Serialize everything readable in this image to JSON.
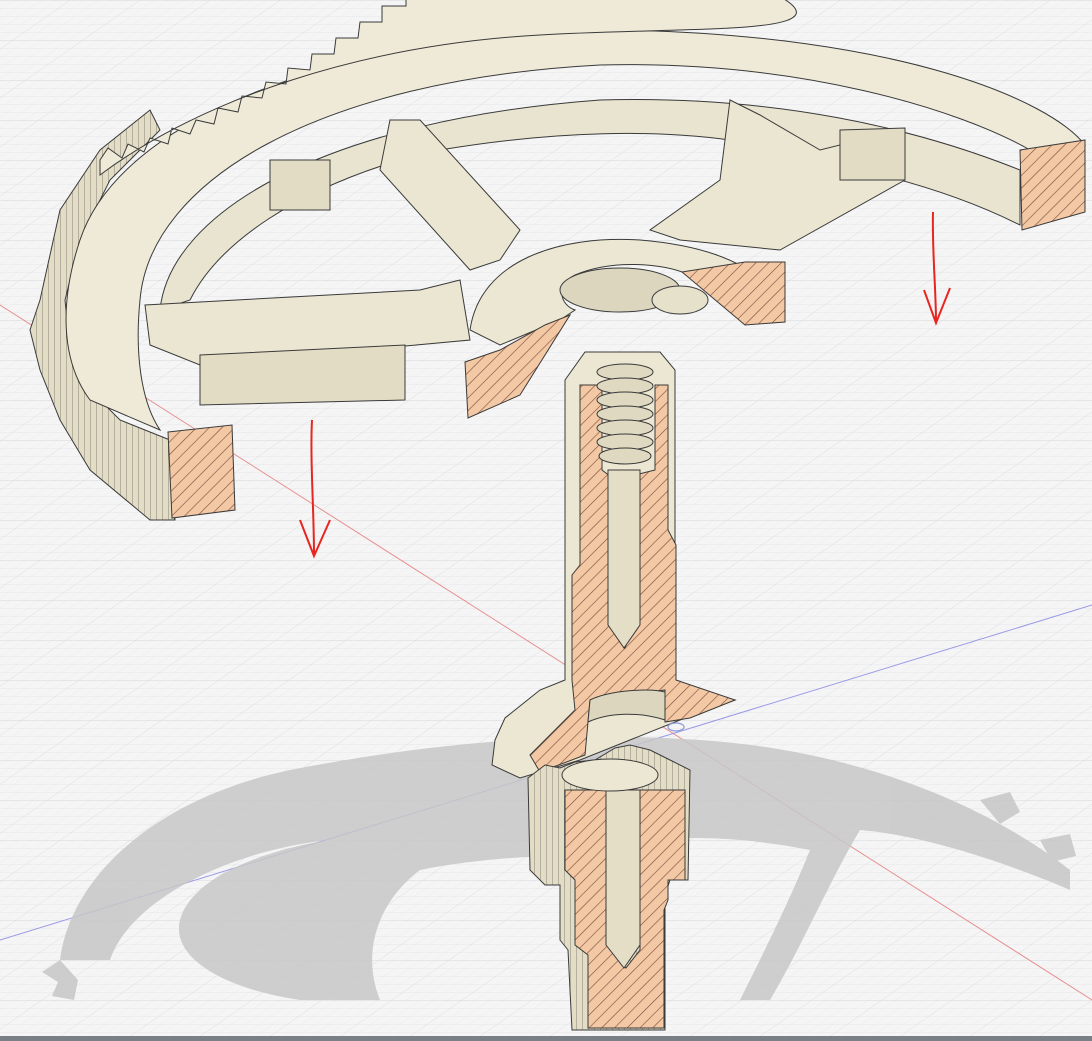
{
  "viewport": {
    "kind": "cad-3d-viewport",
    "model": {
      "parts": [
        "gear-wheel",
        "arbor",
        "pinion"
      ],
      "view": "section-cut",
      "section_hatch_color": "#f3c8a4",
      "body_color": "#ece7d2",
      "shadow_color": "#c9c9c9"
    },
    "grid": {
      "visible": true,
      "major_color": "#d7d9dc",
      "minor_color": "#e6e7e9"
    },
    "axes": {
      "x_axis_color": "#e07070",
      "y_axis_color": "#8080e0"
    },
    "annotations": {
      "arrow_color": "#e8251f",
      "arrow_count": 2,
      "arrow_direction": "down"
    },
    "origin_marker": {
      "visible": true
    }
  }
}
